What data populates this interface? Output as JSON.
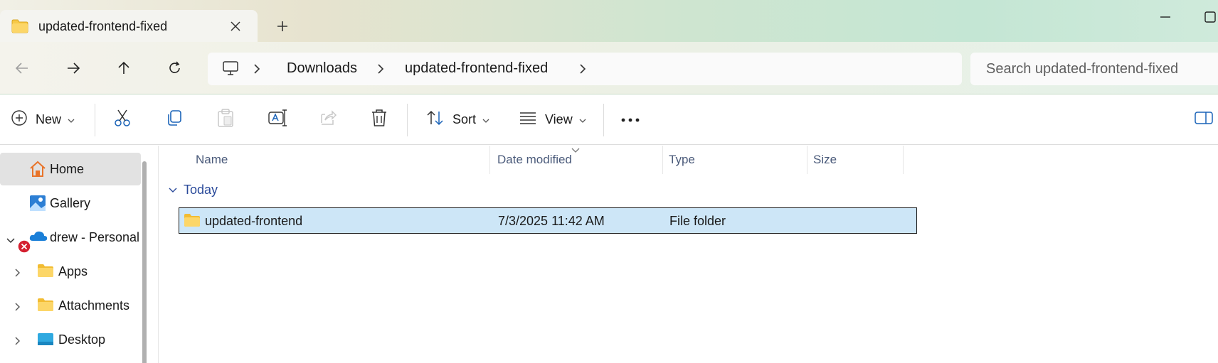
{
  "window": {
    "tab_title": "updated-frontend-fixed",
    "tab_icon": "folder-icon",
    "new_tab_icon": "plus-icon",
    "minimize_icon": "minimize-icon",
    "maximize_icon": "maximize-icon"
  },
  "nav": {
    "back_icon": "arrow-left-icon",
    "forward_icon": "arrow-right-icon",
    "up_icon": "arrow-up-icon",
    "refresh_icon": "refresh-icon"
  },
  "address": {
    "root_icon": "this-pc-icon",
    "crumbs": [
      "Downloads",
      "updated-frontend-fixed"
    ]
  },
  "search": {
    "placeholder": "Search updated-frontend-fixed"
  },
  "toolbar": {
    "new_label": "New",
    "sort_label": "Sort",
    "view_label": "View",
    "icons": [
      "plus-circle-icon",
      "cut-icon",
      "copy-icon",
      "paste-icon",
      "rename-icon",
      "share-icon",
      "delete-icon",
      "sort-icon",
      "view-icon",
      "more-icon",
      "details-pane-icon"
    ]
  },
  "sidebar": {
    "items": [
      {
        "label": "Home",
        "icon": "home-icon",
        "active": true
      },
      {
        "label": "Gallery",
        "icon": "gallery-icon"
      },
      {
        "label": "drew - Personal",
        "icon": "onedrive-icon",
        "expanded": true,
        "status": "error"
      },
      {
        "label": "Apps",
        "icon": "folder-icon"
      },
      {
        "label": "Attachments",
        "icon": "folder-icon"
      },
      {
        "label": "Desktop",
        "icon": "desktop-folder-icon"
      }
    ]
  },
  "list": {
    "columns": [
      "Name",
      "Date modified",
      "Type",
      "Size"
    ],
    "sorted_by": "Date modified",
    "group": "Today",
    "rows": [
      {
        "name": "updated-frontend",
        "date": "7/3/2025 11:42 AM",
        "type": "File folder",
        "size": "",
        "selected": true
      }
    ]
  },
  "colors": {
    "selection": "#cde6f7",
    "accent_blue": "#2a4a9a",
    "folder_yellow": "#f7c948"
  }
}
